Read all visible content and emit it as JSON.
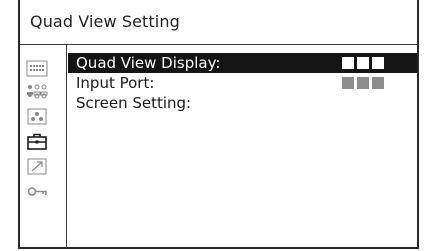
{
  "title": "Quad View Setting",
  "sidebar": {
    "icons": [
      "keypad-icon",
      "people-icon",
      "tripod-icon",
      "toolbox-icon",
      "export-arrow-icon",
      "key-icon"
    ],
    "active_index": 3
  },
  "menu": {
    "items": [
      {
        "label": "Quad View Display:",
        "selected": true,
        "indicator_squares": 3
      },
      {
        "label": "Input Port:",
        "selected": false,
        "indicator_squares": 3
      },
      {
        "label": "Screen Setting:",
        "selected": false,
        "indicator_squares": 0
      }
    ]
  },
  "colors": {
    "selection_bg": "#141414",
    "inactive_square": "#8d8d8d",
    "active_square": "#ffffff"
  }
}
